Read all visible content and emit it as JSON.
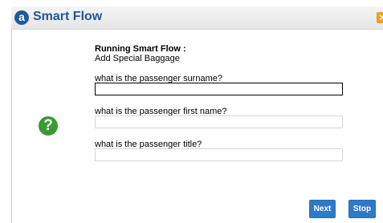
{
  "window": {
    "logo_letter": "a",
    "title": "Smart Flow",
    "close_glyph": "✕"
  },
  "icons": {
    "help": "?"
  },
  "header": {
    "running_label": "Running Smart Flow :",
    "flow_name": "Add Special Baggage"
  },
  "questions": [
    {
      "label": "what is the passenger surname?",
      "value": ""
    },
    {
      "label": "what is the passenger first name?",
      "value": ""
    },
    {
      "label": "what is the passenger title?",
      "value": ""
    }
  ],
  "buttons": {
    "next": "Next",
    "stop": "Stop"
  },
  "colors": {
    "title": "#1e5796",
    "button": "#2f79c8",
    "help_icon": "#3a9a34",
    "close": "#f0a020"
  }
}
